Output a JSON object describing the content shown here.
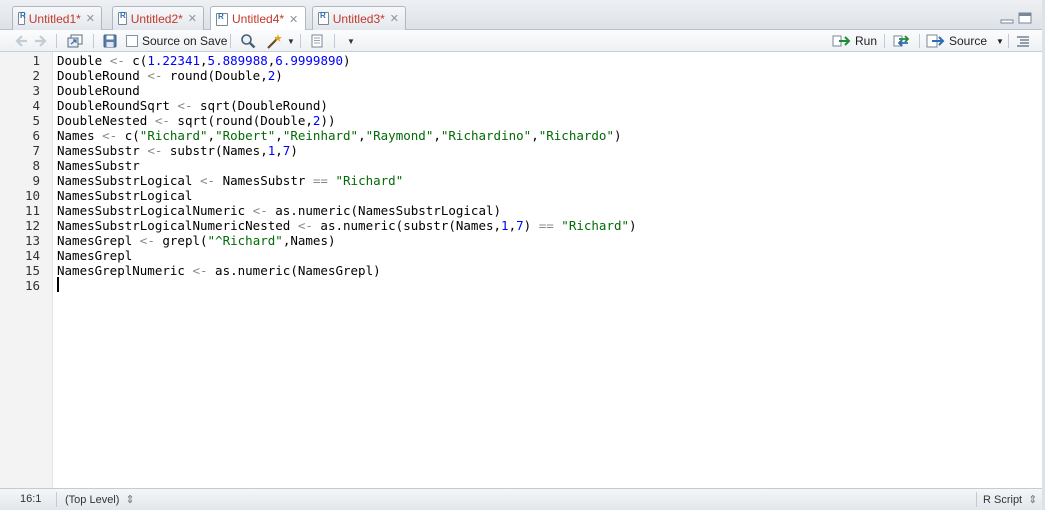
{
  "tabs": [
    {
      "label": "Untitled1*",
      "active": false
    },
    {
      "label": "Untitled2*",
      "active": false
    },
    {
      "label": "Untitled4*",
      "active": true
    },
    {
      "label": "Untitled3*",
      "active": false
    }
  ],
  "toolbar": {
    "source_on_save_label": "Source on Save",
    "run_label": "Run",
    "source_label": "Source"
  },
  "editor": {
    "line_numbers": [
      "1",
      "2",
      "3",
      "4",
      "5",
      "6",
      "7",
      "8",
      "9",
      "10",
      "11",
      "12",
      "13",
      "14",
      "15",
      "16"
    ],
    "lines": [
      "Double <- c(1.22341,5.889988,6.9999890)",
      "DoubleRound <- round(Double,2)",
      "DoubleRound",
      "DoubleRoundSqrt <- sqrt(DoubleRound)",
      "DoubleNested <- sqrt(round(Double,2))",
      "Names <- c(\"Richard\",\"Robert\",\"Reinhard\",\"Raymond\",\"Richardino\",\"Richardo\")",
      "NamesSubstr <- substr(Names,1,7)",
      "NamesSubstr",
      "NamesSubstrLogical <- NamesSubstr == \"Richard\"",
      "NamesSubstrLogical",
      "NamesSubstrLogicalNumeric <- as.numeric(NamesSubstrLogical)",
      "NamesSubstrLogicalNumericNested <- as.numeric(substr(Names,1,7) == \"Richard\")",
      "NamesGrepl <- grepl(\"^Richard\",Names)",
      "NamesGrepl",
      "NamesGreplNumeric <- as.numeric(NamesGrepl)",
      ""
    ]
  },
  "status": {
    "position": "16:1",
    "scope": "(Top Level)",
    "scope_arrow": "⇕",
    "file_type": "R Script",
    "file_type_arrow": "⇕"
  },
  "colors": {
    "tab_text": "#c0392b",
    "number": "#0000ff",
    "string": "#036a07",
    "operator": "#888888",
    "keyword": "#000000"
  }
}
